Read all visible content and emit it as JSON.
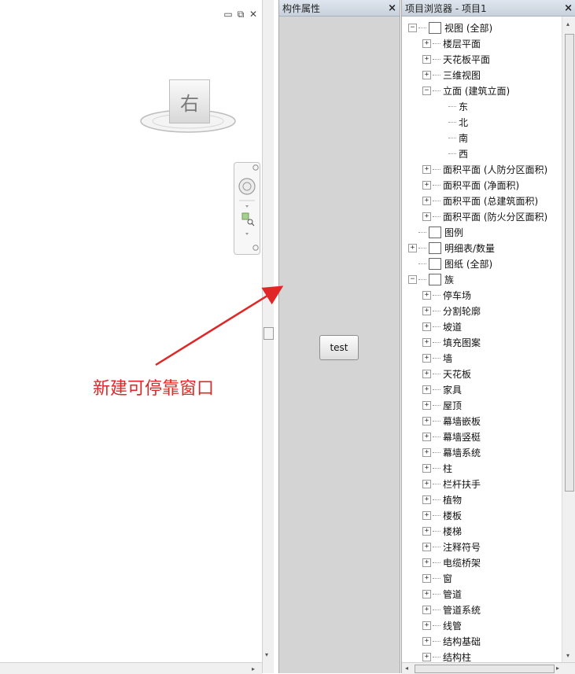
{
  "view": {
    "viewcube_label": "右",
    "controls": [
      "minimize-icon",
      "restore-icon",
      "close-icon"
    ]
  },
  "properties": {
    "title": "构件属性",
    "close_symbol": "×",
    "test_button_label": "test"
  },
  "browser": {
    "title": "项目浏览器 - 项目1",
    "close_symbol": "×",
    "tree": [
      {
        "level": 0,
        "toggle": "−",
        "icon": "view-icon",
        "label": "视图 (全部)"
      },
      {
        "level": 1,
        "toggle": "+",
        "label": "楼层平面"
      },
      {
        "level": 1,
        "toggle": "+",
        "label": "天花板平面"
      },
      {
        "level": 1,
        "toggle": "+",
        "label": "三维视图"
      },
      {
        "level": 1,
        "toggle": "−",
        "label": "立面 (建筑立面)"
      },
      {
        "level": 2,
        "label": "东"
      },
      {
        "level": 2,
        "label": "北"
      },
      {
        "level": 2,
        "label": "南"
      },
      {
        "level": 2,
        "label": "西"
      },
      {
        "level": 1,
        "toggle": "+",
        "label": "面积平面 (人防分区面积)"
      },
      {
        "level": 1,
        "toggle": "+",
        "label": "面积平面 (净面积)"
      },
      {
        "level": 1,
        "toggle": "+",
        "label": "面积平面 (总建筑面积)"
      },
      {
        "level": 1,
        "toggle": "+",
        "label": "面积平面 (防火分区面积)"
      },
      {
        "level": 0,
        "icon": "legend-icon",
        "label": "图例"
      },
      {
        "level": 0,
        "toggle": "+",
        "icon": "schedule-icon",
        "label": "明细表/数量"
      },
      {
        "level": 0,
        "icon": "sheet-icon",
        "label": "图纸 (全部)"
      },
      {
        "level": 0,
        "toggle": "−",
        "icon": "family-icon",
        "label": "族"
      },
      {
        "level": 1,
        "toggle": "+",
        "label": "停车场"
      },
      {
        "level": 1,
        "toggle": "+",
        "label": "分割轮廓"
      },
      {
        "level": 1,
        "toggle": "+",
        "label": "坡道"
      },
      {
        "level": 1,
        "toggle": "+",
        "label": "填充图案"
      },
      {
        "level": 1,
        "toggle": "+",
        "label": "墙"
      },
      {
        "level": 1,
        "toggle": "+",
        "label": "天花板"
      },
      {
        "level": 1,
        "toggle": "+",
        "label": "家具"
      },
      {
        "level": 1,
        "toggle": "+",
        "label": "屋顶"
      },
      {
        "level": 1,
        "toggle": "+",
        "label": "幕墙嵌板"
      },
      {
        "level": 1,
        "toggle": "+",
        "label": "幕墙竖梃"
      },
      {
        "level": 1,
        "toggle": "+",
        "label": "幕墙系统"
      },
      {
        "level": 1,
        "toggle": "+",
        "label": "柱"
      },
      {
        "level": 1,
        "toggle": "+",
        "label": "栏杆扶手"
      },
      {
        "level": 1,
        "toggle": "+",
        "label": "植物"
      },
      {
        "level": 1,
        "toggle": "+",
        "label": "楼板"
      },
      {
        "level": 1,
        "toggle": "+",
        "label": "楼梯"
      },
      {
        "level": 1,
        "toggle": "+",
        "label": "注释符号"
      },
      {
        "level": 1,
        "toggle": "+",
        "label": "电缆桥架"
      },
      {
        "level": 1,
        "toggle": "+",
        "label": "窗"
      },
      {
        "level": 1,
        "toggle": "+",
        "label": "管道"
      },
      {
        "level": 1,
        "toggle": "+",
        "label": "管道系统"
      },
      {
        "level": 1,
        "toggle": "+",
        "label": "线管"
      },
      {
        "level": 1,
        "toggle": "+",
        "label": "结构基础"
      },
      {
        "level": 1,
        "toggle": "+",
        "label": "结构柱"
      }
    ]
  },
  "annotation": {
    "text": "新建可停靠窗口",
    "color": "#e02626"
  }
}
